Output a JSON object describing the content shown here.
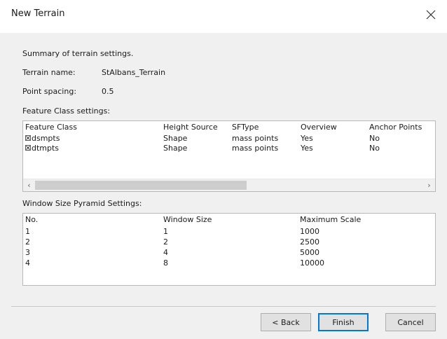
{
  "window": {
    "title": "New Terrain"
  },
  "summary": "Summary of terrain settings.",
  "terrain": {
    "name_label": "Terrain name:",
    "name_value": "StAlbans_Terrain",
    "spacing_label": "Point spacing:",
    "spacing_value": "0.5"
  },
  "feature_class": {
    "section_label": "Feature Class settings:",
    "columns": [
      "Feature Class",
      "Height Source",
      "SFType",
      "Overview",
      "Anchor Points"
    ],
    "rows": [
      {
        "name": "dsmpts",
        "height_source": "Shape",
        "sftype": "mass points",
        "overview": "Yes",
        "anchor": "No",
        "checked": true
      },
      {
        "name": "dtmpts",
        "height_source": "Shape",
        "sftype": "mass points",
        "overview": "Yes",
        "anchor": "No",
        "checked": true
      }
    ],
    "scroll_left": "‹",
    "scroll_right": "›"
  },
  "pyramid": {
    "section_label": "Window Size Pyramid Settings:",
    "columns": [
      "No.",
      "Window Size",
      "Maximum Scale"
    ],
    "rows": [
      {
        "no": "1",
        "window_size": "1",
        "max_scale": "1000"
      },
      {
        "no": "2",
        "window_size": "2",
        "max_scale": "2500"
      },
      {
        "no": "3",
        "window_size": "4",
        "max_scale": "5000"
      },
      {
        "no": "4",
        "window_size": "8",
        "max_scale": "10000"
      }
    ]
  },
  "buttons": {
    "back": "< Back",
    "finish": "Finish",
    "cancel": "Cancel"
  }
}
